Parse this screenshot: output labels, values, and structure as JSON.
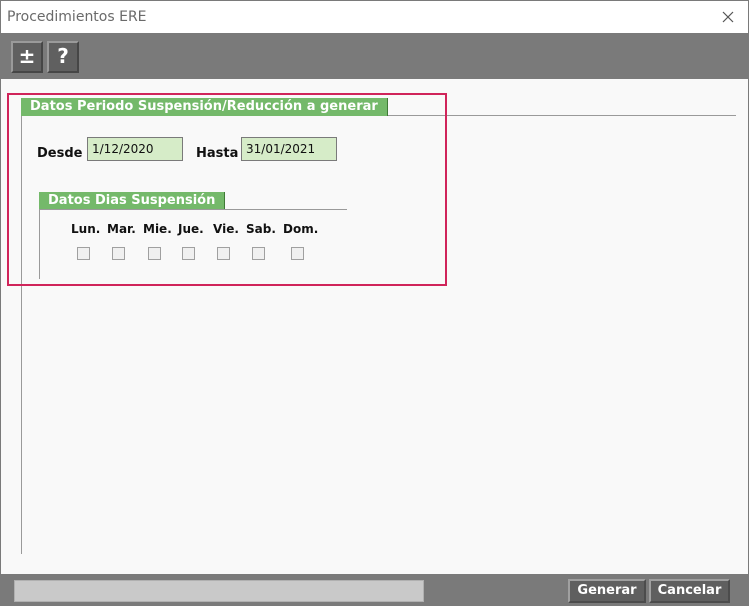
{
  "window": {
    "title": "Procedimientos ERE"
  },
  "toolbar": {
    "plusminus_label": "±",
    "help_label": "?"
  },
  "period_group": {
    "title": "Datos Periodo Suspensión/Reducción a generar",
    "desde_label": "Desde",
    "desde_value": "1/12/2020",
    "hasta_label": "Hasta",
    "hasta_value": "31/01/2021"
  },
  "days_group": {
    "title": "Datos Dias Suspensión",
    "days": [
      {
        "label": "Lun.",
        "checked": false
      },
      {
        "label": "Mar.",
        "checked": false
      },
      {
        "label": "Mie.",
        "checked": false
      },
      {
        "label": "Jue.",
        "checked": false
      },
      {
        "label": "Vie.",
        "checked": false
      },
      {
        "label": "Sab.",
        "checked": false
      },
      {
        "label": "Dom.",
        "checked": false
      }
    ]
  },
  "footer": {
    "generar_label": "Generar",
    "cancelar_label": "Cancelar"
  },
  "colors": {
    "accent_green": "#74b96a",
    "field_green": "#d6ecc8",
    "highlight": "#d0245a",
    "toolbar_gray": "#7a7a7a"
  }
}
